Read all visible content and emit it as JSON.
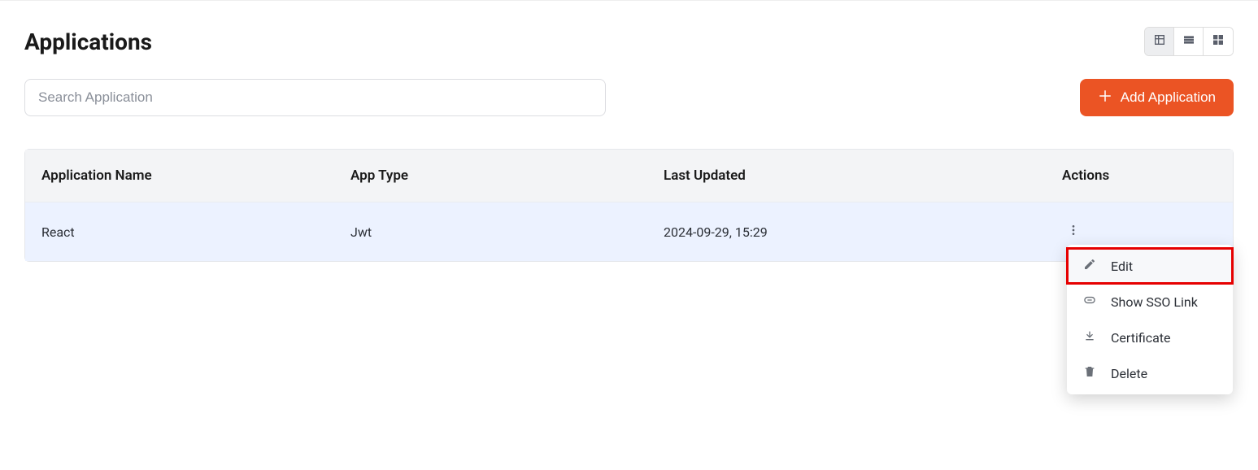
{
  "page": {
    "title": "Applications"
  },
  "search": {
    "placeholder": "Search Application"
  },
  "buttons": {
    "add": "Add Application"
  },
  "table": {
    "headers": {
      "name": "Application Name",
      "type": "App Type",
      "updated": "Last Updated",
      "actions": "Actions"
    },
    "rows": [
      {
        "name": "React",
        "type": "Jwt",
        "updated": "2024-09-29, 15:29"
      }
    ]
  },
  "menu": {
    "edit": "Edit",
    "show_sso": "Show SSO Link",
    "certificate": "Certificate",
    "delete": "Delete"
  }
}
